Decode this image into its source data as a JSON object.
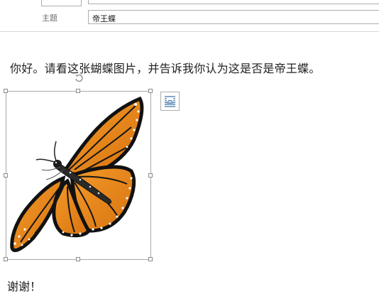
{
  "compose": {
    "subject_label": "主题",
    "subject_value": "帝王蝶"
  },
  "message": {
    "line1": "你好。请看这张蝴蝶图片，并告诉我你认为这是否是帝王蝶。",
    "line2": "谢谢！"
  },
  "image": {
    "subject": "monarch butterfly",
    "wing_color": "#e8871e",
    "vein_color": "#1a1a1a"
  },
  "icons": {
    "rotate": "rotate-handle-icon",
    "layout": "layout-options-icon"
  }
}
